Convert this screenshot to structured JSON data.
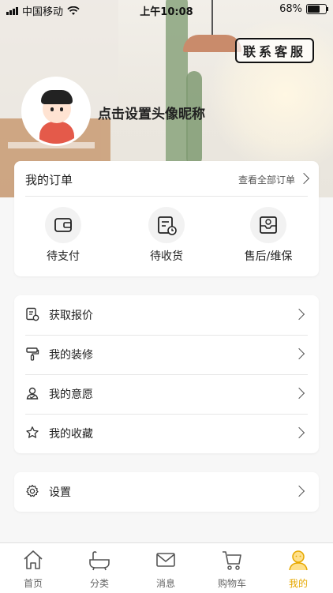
{
  "status_bar": {
    "carrier": "中国移动",
    "time": "上午10:08",
    "battery": "68%"
  },
  "header": {
    "customer_service_label": "联系客服",
    "nickname_prompt": "点击设置头像昵称"
  },
  "orders": {
    "title": "我的订单",
    "view_all_label": "查看全部订单",
    "items": [
      {
        "label": "待支付",
        "icon": "wallet-icon"
      },
      {
        "label": "待收货",
        "icon": "delivery-icon"
      },
      {
        "label": "售后/维保",
        "icon": "after-sales-icon"
      }
    ]
  },
  "menu": {
    "items": [
      {
        "label": "获取报价",
        "icon": "quote-icon"
      },
      {
        "label": "我的装修",
        "icon": "paint-roller-icon"
      },
      {
        "label": "我的意愿",
        "icon": "user-intent-icon"
      },
      {
        "label": "我的收藏",
        "icon": "star-icon"
      }
    ]
  },
  "settings": {
    "label": "设置",
    "icon": "gear-icon"
  },
  "tabbar": {
    "items": [
      {
        "label": "首页",
        "icon": "home-icon"
      },
      {
        "label": "分类",
        "icon": "bathtub-icon"
      },
      {
        "label": "消息",
        "icon": "mail-icon"
      },
      {
        "label": "购物车",
        "icon": "cart-icon"
      },
      {
        "label": "我的",
        "icon": "profile-icon"
      }
    ],
    "active": "我的",
    "accent_color": "#e6a800"
  }
}
